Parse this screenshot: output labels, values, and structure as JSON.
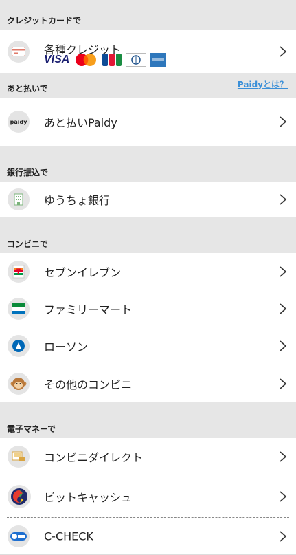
{
  "credit": {
    "header": "クレジットカードで",
    "item_label": "各種クレジット",
    "brands": [
      "VISA",
      "MasterCard",
      "JCB",
      "Diners Club",
      "AMEX"
    ]
  },
  "later": {
    "header": "あと払いで",
    "help_link": "Paidyとは？",
    "item_label": "あと払いPaidy",
    "icon_text": "paidy"
  },
  "bank": {
    "header": "銀行振込で",
    "item_label": "ゆうちょ銀行"
  },
  "konbini": {
    "header": "コンビニで",
    "items": [
      {
        "label": "セブンイレブン",
        "icon": "seven-eleven-icon"
      },
      {
        "label": "ファミリーマート",
        "icon": "familymart-icon"
      },
      {
        "label": "ローソン",
        "icon": "lawson-icon"
      },
      {
        "label": "その他のコンビニ",
        "icon": "monkey-mascot-icon"
      }
    ]
  },
  "emoney": {
    "header": "電子マネーで",
    "items": [
      {
        "label": "コンビニダイレクト",
        "icon": "konbini-direct-icon"
      },
      {
        "label": "ビットキャッシュ",
        "icon": "bitcash-icon"
      },
      {
        "label": "C-CHECK",
        "icon": "c-check-icon"
      }
    ]
  },
  "colors": {
    "link": "#3a8fd8",
    "section_bg": "#e6e6e6",
    "row_bg": "#ffffff"
  }
}
